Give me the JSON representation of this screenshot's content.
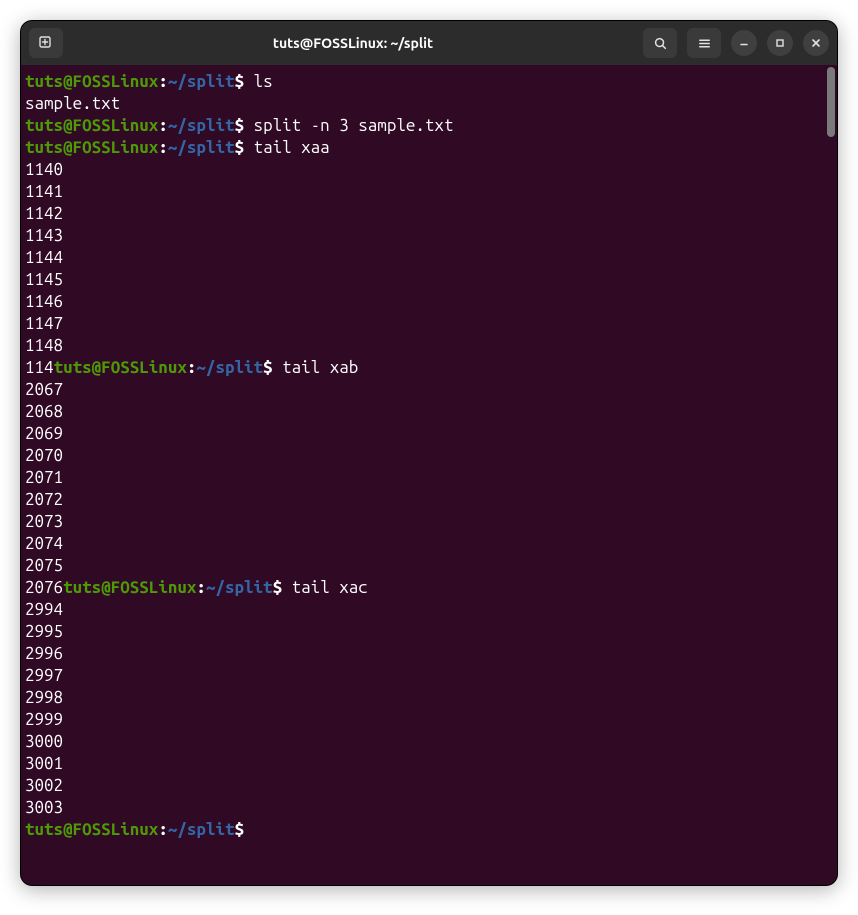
{
  "titlebar": {
    "title": "tuts@FOSSLinux: ~/split"
  },
  "prompt": {
    "user": "tuts",
    "at": "@",
    "host": "FOSSLinux",
    "colon": ":",
    "path": "~/split",
    "dollar": "$"
  },
  "session": {
    "cmd1": "ls",
    "out1_0": "sample.txt",
    "cmd2": "split -n 3 sample.txt",
    "cmd3": "tail xaa",
    "xaa": [
      "1140",
      "1141",
      "1142",
      "1143",
      "1144",
      "1145",
      "1146",
      "1147",
      "1148"
    ],
    "partial_before_cmd4": "114",
    "cmd4": "tail xab",
    "xab": [
      "2067",
      "2068",
      "2069",
      "2070",
      "2071",
      "2072",
      "2073",
      "2074",
      "2075"
    ],
    "partial_before_cmd5": "2076",
    "cmd5": "tail xac",
    "xac": [
      "2994",
      "2995",
      "2996",
      "2997",
      "2998",
      "2999",
      "3000",
      "3001",
      "3002",
      "3003"
    ]
  }
}
